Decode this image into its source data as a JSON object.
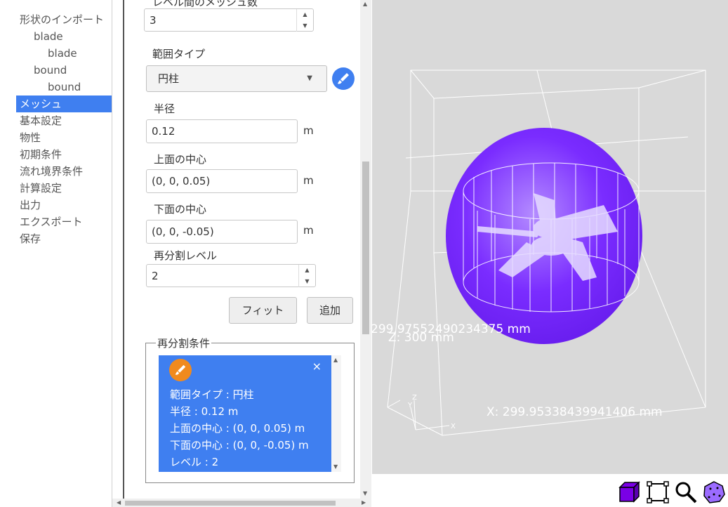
{
  "nav": {
    "items": [
      {
        "label": "形状のインポート"
      },
      {
        "label": "blade"
      },
      {
        "label": "blade"
      },
      {
        "label": "bound"
      },
      {
        "label": "bound"
      },
      {
        "label": "メッシュ"
      },
      {
        "label": "基本設定"
      },
      {
        "label": "物性"
      },
      {
        "label": "初期条件"
      },
      {
        "label": "流れ境界条件"
      },
      {
        "label": "計算設定"
      },
      {
        "label": "出力"
      },
      {
        "label": "エクスポート"
      },
      {
        "label": "保存"
      }
    ],
    "active_index": 5
  },
  "form": {
    "mesh_count_label": "レベル間のメッシュ数",
    "mesh_count_value": "3",
    "range_type_label": "範囲タイプ",
    "range_type_value": "円柱",
    "radius_label": "半径",
    "radius_value": "0.12",
    "radius_unit": "m",
    "top_center_label": "上面の中心",
    "top_center_value": "(0, 0, 0.05)",
    "top_center_unit": "m",
    "bottom_center_label": "下面の中心",
    "bottom_center_value": "(0, 0, -0.05)",
    "bottom_center_unit": "m",
    "level_label": "再分割レベル",
    "level_value": "2",
    "fit_button": "フィット",
    "add_button": "追加"
  },
  "condition": {
    "legend": "再分割条件",
    "close": "×",
    "lines": [
      "範囲タイプ : 円柱",
      "半径 : 0.12 m",
      "上面の中心 : (0, 0, 0.05) m",
      "下面の中心 : (0, 0, -0.05) m",
      "レベル : 2"
    ]
  },
  "viewport": {
    "y_dim": "299.97552490234375 mm",
    "z_dim": "Z: 300 mm",
    "x_dim": "X: 299.95338439941406 mm",
    "axis_x": "X",
    "axis_y": "Y",
    "axis_z": "Z"
  },
  "colors": {
    "accent": "#3f7ff0",
    "mesh_region": "#7a2cff",
    "icon_orange": "#f08a1e",
    "viewport_bg": "#d9d9d9"
  },
  "toolbar": {
    "icons": [
      "solid-cube-icon",
      "bounding-box-icon",
      "zoom-icon",
      "polyhedron-icon"
    ]
  }
}
